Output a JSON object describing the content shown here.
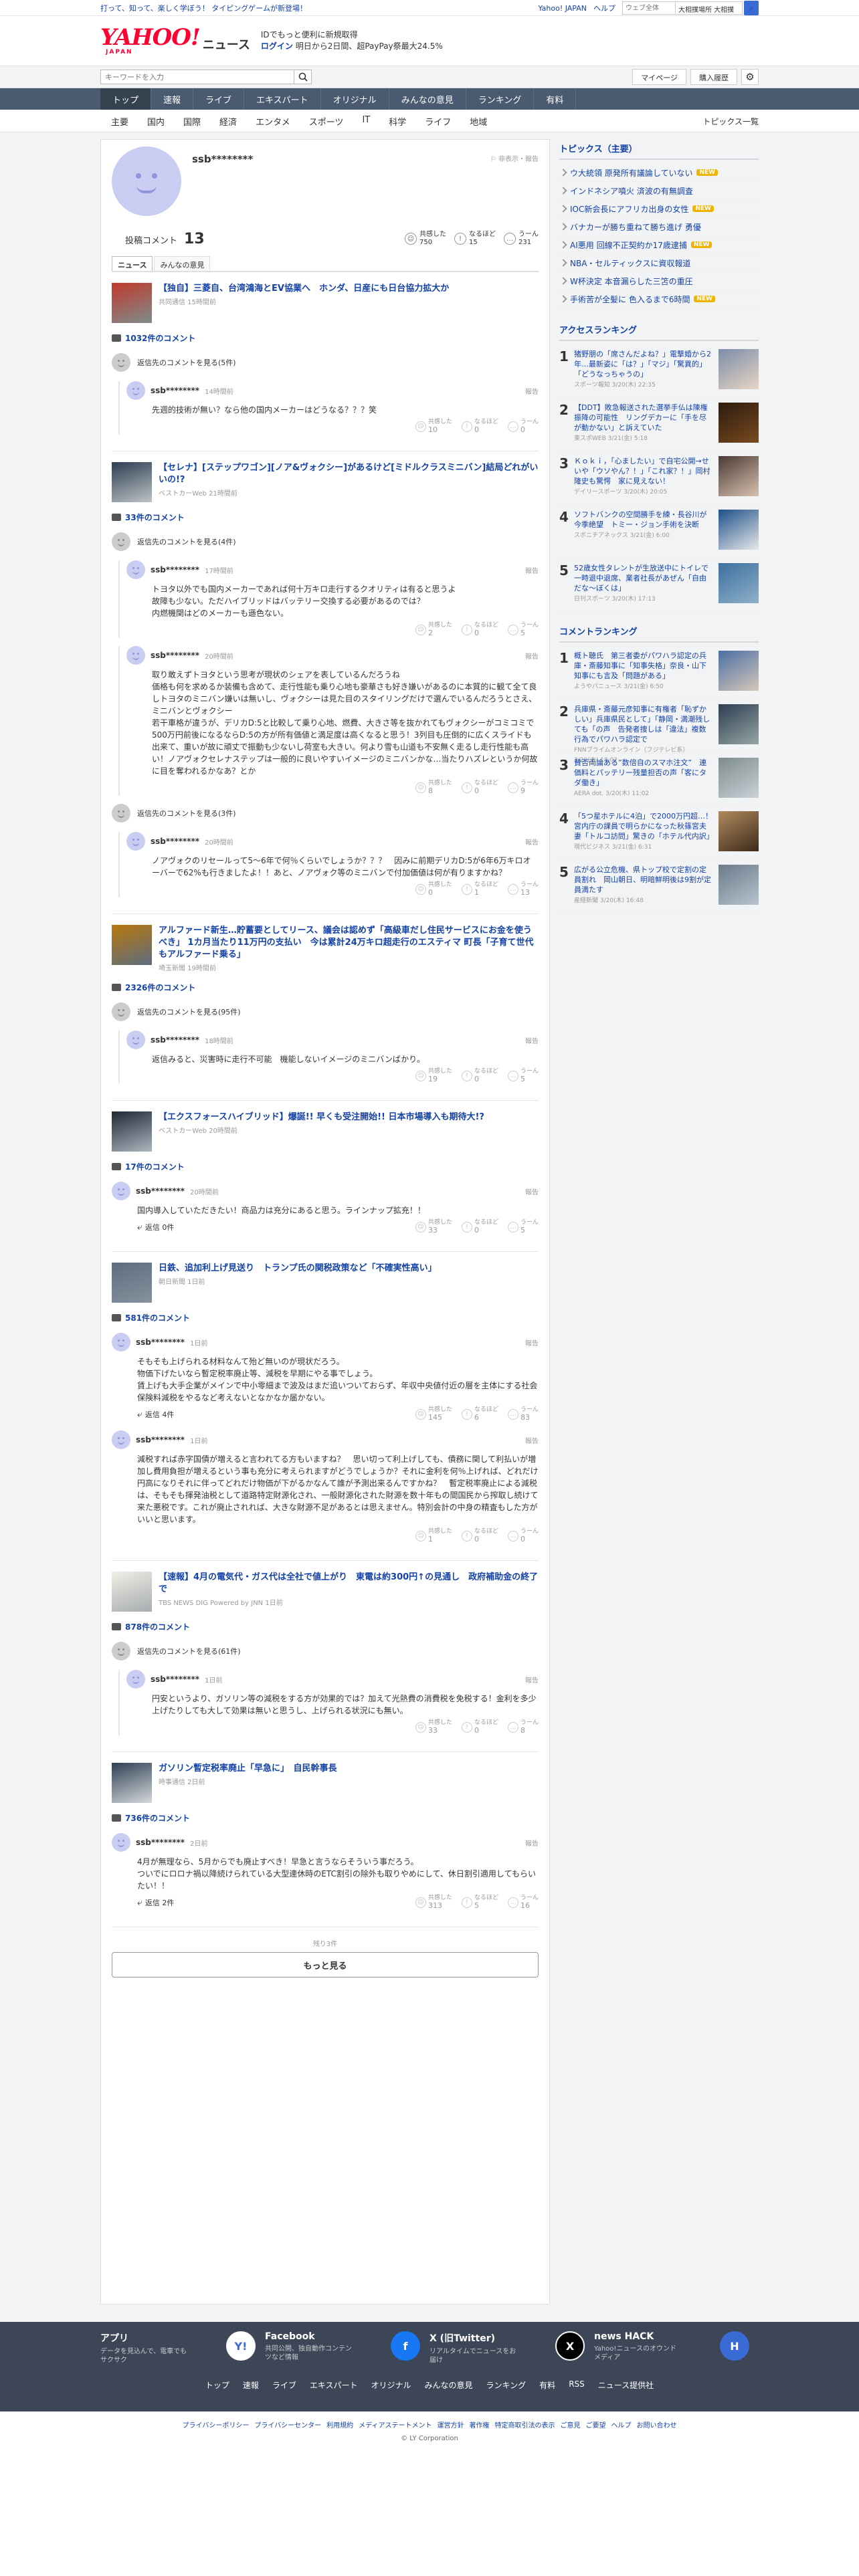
{
  "topbar": {
    "promo": "打って、知って、楽しく学ぼう！ タイピングゲームが新登場！",
    "links": [
      "Yahoo! JAPAN",
      "ヘルプ"
    ],
    "search_placeholder": "ウェブ全体",
    "search_select": "大相撲場所 大相撲"
  },
  "header": {
    "logo": "YAHOO!",
    "logo_sub": "JAPAN",
    "logo_news": "ニュース",
    "promo_line1": "IDでもっと便利に新規取得",
    "promo_line2a": "ログイン",
    "promo_line2b": "明日から2日間、超PayPay祭最大24.5%"
  },
  "searchband": {
    "placeholder": "キーワードを入力",
    "mypage": "マイページ",
    "purchase": "購入履歴"
  },
  "nav": {
    "items": [
      "トップ",
      "速報",
      "ライブ",
      "エキスパート",
      "オリジナル",
      "みんなの意見",
      "ランキング",
      "有料"
    ]
  },
  "subnav": {
    "items": [
      "主要",
      "国内",
      "国際",
      "経済",
      "エンタメ",
      "スポーツ",
      "IT",
      "科学",
      "ライフ",
      "地域"
    ],
    "right": "トピックス一覧"
  },
  "profile": {
    "name": "ssb********",
    "flag": "非表示・報告",
    "comments_label": "投稿コメント",
    "comments_count": "13",
    "reactions": [
      {
        "label": "共感した",
        "value": "750"
      },
      {
        "label": "なるほど",
        "value": "15"
      },
      {
        "label": "うーん",
        "value": "231"
      }
    ],
    "tabs": [
      "ニュース",
      "みんなの意見"
    ]
  },
  "articles": [
    {
      "title": "【独自】三菱自、台湾鴻海とEV協業へ　ホンダ、日産にも日台協力拡大か",
      "source": "共同通信 15時間前",
      "count": "1032件のコメント",
      "prev": "返信先のコメントを見る(5件)",
      "comments": [
        {
          "user": "ssb********",
          "date": "14時間前",
          "text": "先週的技術が無い？なら他の国内メーカーはどうなる？？？笑",
          "reactions": [
            "10",
            "0",
            "0"
          ],
          "reply": ""
        }
      ]
    },
    {
      "title": "【セレナ】[ステップワゴン][ノア&ヴォクシー]があるけど[ミドルクラスミニバン]結局どれがいいの!?",
      "source": "ベストカーWeb 21時間前",
      "count": "33件のコメント",
      "prev": "返信先のコメントを見る(4件)",
      "comments": [
        {
          "user": "ssb********",
          "date": "17時間前",
          "text": "トヨタ以外でも国内メーカーであれば何十万キロ走行するクオリティは有ると思うよ\n故障も少ない。ただハイブリッドはバッテリー交換する必要があるのでは？\n内燃機関はどのメーカーも遜色ない。",
          "reactions": [
            "2",
            "0",
            "5"
          ],
          "reply": ""
        },
        {
          "user": "ssb********",
          "date": "20時間前",
          "text": "取り敢えずトヨタという思考が現状のシェアを表しているんだろうね\n価格も何を求めるか装備も含めて、走行性能も乗り心地も豪華さも好き嫌いがあるのに本質的に観て全て良しトヨタのミニバン嫌いは無いし、ヴォクシーは見た目のスタイリングだけで選んでいるんだろうとさえ、ミニバンとヴォクシー\n若干車格が違うが、デリカD:5と比較して乗り心地、燃費、大きさ等を抜かれてもヴォクシーがコミコミで500万円前後になるならD:5の方が所有価値と満足度は高くなると思う！3列目も圧倒的に広くスライドも出来て、重いが故に頑丈で振動も少ないし荷室も大きい。何より雪も山道も不安無く走るし走行性能も高い！ノアヴォクセレナステップは一般的に良いやすいイメージのミニバンかな…当たりハズレというか何故に目を奪われるかなあ？とか",
          "reactions": [
            "8",
            "0",
            "9"
          ],
          "reply": ""
        }
      ],
      "prev2": "返信先のコメントを見る(3件)",
      "comments2": [
        {
          "user": "ssb********",
          "date": "20時間前",
          "text": "ノアヴォクのリセールって5～6年で何％くらいでしょうか？？？　因みに前期デリカD:5が6年6万キロオーバーで62%も行きましたよ！！あと、ノアヴォク等のミニバンで付加価値は何が有りますかね？",
          "reactions": [
            "0",
            "1",
            "13"
          ],
          "reply": ""
        }
      ]
    },
    {
      "title": "アルファード新生…貯蓄要としてリース、議会は認めず「高級車だし住民サービスにお金を使うべき」 1カ月当たり11万円の支払い　今は累計24万キロ超走行のエスティマ 町長「子育て世代もアルファード乗る」",
      "source": "埼玉新聞 19時間前",
      "count": "2326件のコメント",
      "prev": "返信先のコメントを見る(95件)",
      "comments": [
        {
          "user": "ssb********",
          "date": "18時間前",
          "text": "返信みると、災害時に走行不可能　機能しないイメージのミニバンばかり。",
          "reactions": [
            "19",
            "0",
            "5"
          ],
          "reply": ""
        }
      ]
    },
    {
      "title": "【エクスフォースハイブリッド】爆誕!! 早くも受注開始!! 日本市場導入も期待大!?",
      "source": "ベストカーWeb 20時間前",
      "count": "17件のコメント",
      "prev": "",
      "comments": [
        {
          "user": "ssb********",
          "date": "20時間前",
          "text": "国内導入していただきたい！商品力は充分にあると思う。ラインナップ拡充！！",
          "reactions": [
            "33",
            "0",
            "5"
          ],
          "reply": "返信 0件"
        }
      ]
    },
    {
      "title": "日鉄、追加利上げ見送り　トランプ氏の関税政策など「不確実性高い」",
      "source": "朝日新聞 1日前",
      "count": "581件のコメント",
      "prev": "",
      "comments": [
        {
          "user": "ssb********",
          "date": "1日前",
          "text": "そもそも上げられる材料なんて殆ど無いのが現状だろう。\n物価下げたいなら暫定税率廃止等、減税を早期にやる事でしょう。\n賃上げも大手企業がメインで中小零細まで波及はまだ追いついておらず、年収中央値付近の層を主体にする社会保険料減税をやるなど考えないとなかなか届かない。",
          "reactions": [
            "145",
            "6",
            "83"
          ],
          "reply": "返信 4件"
        },
        {
          "user": "ssb********",
          "date": "1日前",
          "text": "減税すれば赤字国債が増えると言われてる方もいますね？　思い切って利上げしても、債務に関して利払いが増加し費用負担が増えるという事も充分に考えられますがどうでしょうか？それに金利を何％上げれば、どれだけ円高になりそれに伴ってどれだけ物価が下がるかなんて誰が予測出来るんですかね？　暫定税率廃止による減税は、そもそも揮発油税として道路特定財源化され、一般財源化された財源を数十年もの間国民から搾取し続けて来た悪税です。これが廃止されれば、大きな財源不足があるとは思えません。特別会計の中身の精査もした方がいいと思います。",
          "reactions": [
            "1",
            "0",
            "0"
          ],
          "reply": ""
        }
      ]
    },
    {
      "title": "【速報】4月の電気代・ガス代は全社で値上がり　東電は約300円↑の見通し　政府補助金の終了で",
      "source": "TBS NEWS DIG Powered by JNN 1日前",
      "count": "878件のコメント",
      "prev": "返信先のコメントを見る(61件)",
      "comments": [
        {
          "user": "ssb********",
          "date": "1日前",
          "text": "円安というより、ガソリン等の減税をする方が効果的では？加えて光熱費の消費税を免税する！金利を多少上げたりしても大して効果は無いと思うし、上げられる状況にも無い。",
          "reactions": [
            "33",
            "0",
            "8"
          ],
          "reply": ""
        }
      ]
    },
    {
      "title": "ガソリン暫定税率廃止「早急に」　自民幹事長",
      "source": "時事通信 2日前",
      "count": "736件のコメント",
      "prev": "",
      "comments": [
        {
          "user": "ssb********",
          "date": "2日前",
          "text": "4月が無理なら、5月からでも廃止すべき！早急と言うならそういう事だろう。\nついでにロロナ禍以降続けられている大型連休時のETC割引の除外も取りやめにして、休日割引適用してもらいたい！！",
          "reactions": [
            "313",
            "5",
            "16"
          ],
          "reply": "返信 2件"
        }
      ]
    }
  ],
  "more": {
    "remaining": "残り3件",
    "button": "もっと見る"
  },
  "sidebar": {
    "topics_title": "トピックス（主要）",
    "topics": [
      {
        "text": "ウ大統領 原発所有議論していない",
        "new": true
      },
      {
        "text": "インドネシア噴火 済波の有無調査",
        "new": false
      },
      {
        "text": "IOC新会長にアフリカ出身の女性",
        "new": true
      },
      {
        "text": "バナカーが勝ち重ねて勝ち進げ 勇優",
        "new": false
      },
      {
        "text": "AI悪用 回線不正契約か17歳逮捕",
        "new": true
      },
      {
        "text": "NBA・セルティックスに資収報道",
        "new": false
      },
      {
        "text": "W杯決定 本音漏らした三笘の重圧",
        "new": false
      },
      {
        "text": "手術苦が全髪に 色入るまで6時間",
        "new": true
      }
    ],
    "access_title": "アクセスランキング",
    "access": [
      {
        "no": "1",
        "text": "猪野朋の「席さんだよね？」電撃婚から2年…最新姿に「は？」「マジ」「驚異的」「どうなっちゃうの」",
        "meta": "スポーツ報知 3/20(木) 22:35"
      },
      {
        "no": "2",
        "text": "【DDT】敗急報送された選挙手仏は陳権振降の可能性　リングデカーに「手を尽が動かない」と訴えていた",
        "meta": "東スポWEB 3/21(金) 5:18"
      },
      {
        "no": "3",
        "text": "Ｋｏｋｉ，「心ましたい」で自宅公開→せいや「ウソやん？！」「これ家？！」岡村隆史も驚愕　家に見えない！",
        "meta": "デイリースポーツ 3/20(木) 20:05"
      },
      {
        "no": "4",
        "text": "ソフトバンクの空間勝手を練・長谷川が今季絶望　トミー・ジョン手術を決断",
        "meta": "スポニチアネックス 3/21(金) 6:00"
      },
      {
        "no": "5",
        "text": "52歳女性タレントが生放送中にトイレで一時退中退席、業者社長があぜん「自由だな～ぼくは」",
        "meta": "日刊スポーツ 3/20(木) 17:13"
      }
    ],
    "comment_title": "コメントランキング",
    "comment": [
      {
        "no": "1",
        "text": "概ト聴氏　第三者委がパワハラ認定の兵庫・斎藤知事に「知事失格」奈良・山下知事にも言及「問題がある」",
        "meta": "ようやパニュース 3/21(金) 6:50"
      },
      {
        "no": "2",
        "text": "兵庫県・斎藤元彦知事に有権者「恥ずかしい」兵庫県民として」「静岡・満潮残しても「の声　告発者捜しは「違法」複数行為でパワハラ認定で",
        "meta": "FNNプライムオンライン（フジテレビ系） 3/20(木) 18:02"
      },
      {
        "no": "3",
        "text": "賛否両論ある”数倍自のスマホ注文”　連価料とパッテリー残量担否の声「客にタダ働き」",
        "meta": "AERA dot. 3/20(木) 11:02"
      },
      {
        "no": "4",
        "text": "「5つ星ホテルに4泊」で2000万円超…！宮内庁の課員で明らかになった秋篠宮夫妻「トルコ訪問」驚きの「ホテル代内訳」",
        "meta": "現代ビジネス 3/21(金) 6:31"
      },
      {
        "no": "5",
        "text": "広がる公立危機、県トップ校で定割の定員割れ　岡山朝日、明暗鮮明後は9割が定員満たす",
        "meta": "産経新聞 3/20(木) 16:48"
      }
    ]
  },
  "footer": {
    "cols": [
      {
        "title": "アプリ",
        "desc": "データを見込んで、電車でもサクサク",
        "icon": "Y!"
      },
      {
        "title": "Facebook",
        "desc": "共同公開、独自動作コンテンツなど情報",
        "icon": "f"
      },
      {
        "title": "X (旧Twitter)",
        "desc": "リアルタイムでニュースをお届け",
        "icon": "X"
      },
      {
        "title": "news HACK",
        "desc": "Yahoo!ニュースのオウンドメディア",
        "icon": "H"
      }
    ],
    "nav": [
      "トップ",
      "速報",
      "ライブ",
      "エキスパート",
      "オリジナル",
      "みんなの意見",
      "ランキング",
      "有料",
      "RSS",
      "ニュース提供社"
    ],
    "legal": [
      "プライバシーポリシー",
      "プライバシーセンター",
      "利用規約",
      "メディアステートメント",
      "運営方針",
      "著作権",
      "特定商取引法の表示",
      "ご意見",
      "ご要望",
      "ヘルプ",
      "お問い合わせ"
    ],
    "copyright": "© LY Corporation"
  },
  "reaction_labels": [
    "共感した",
    "なるほど",
    "うーん"
  ]
}
